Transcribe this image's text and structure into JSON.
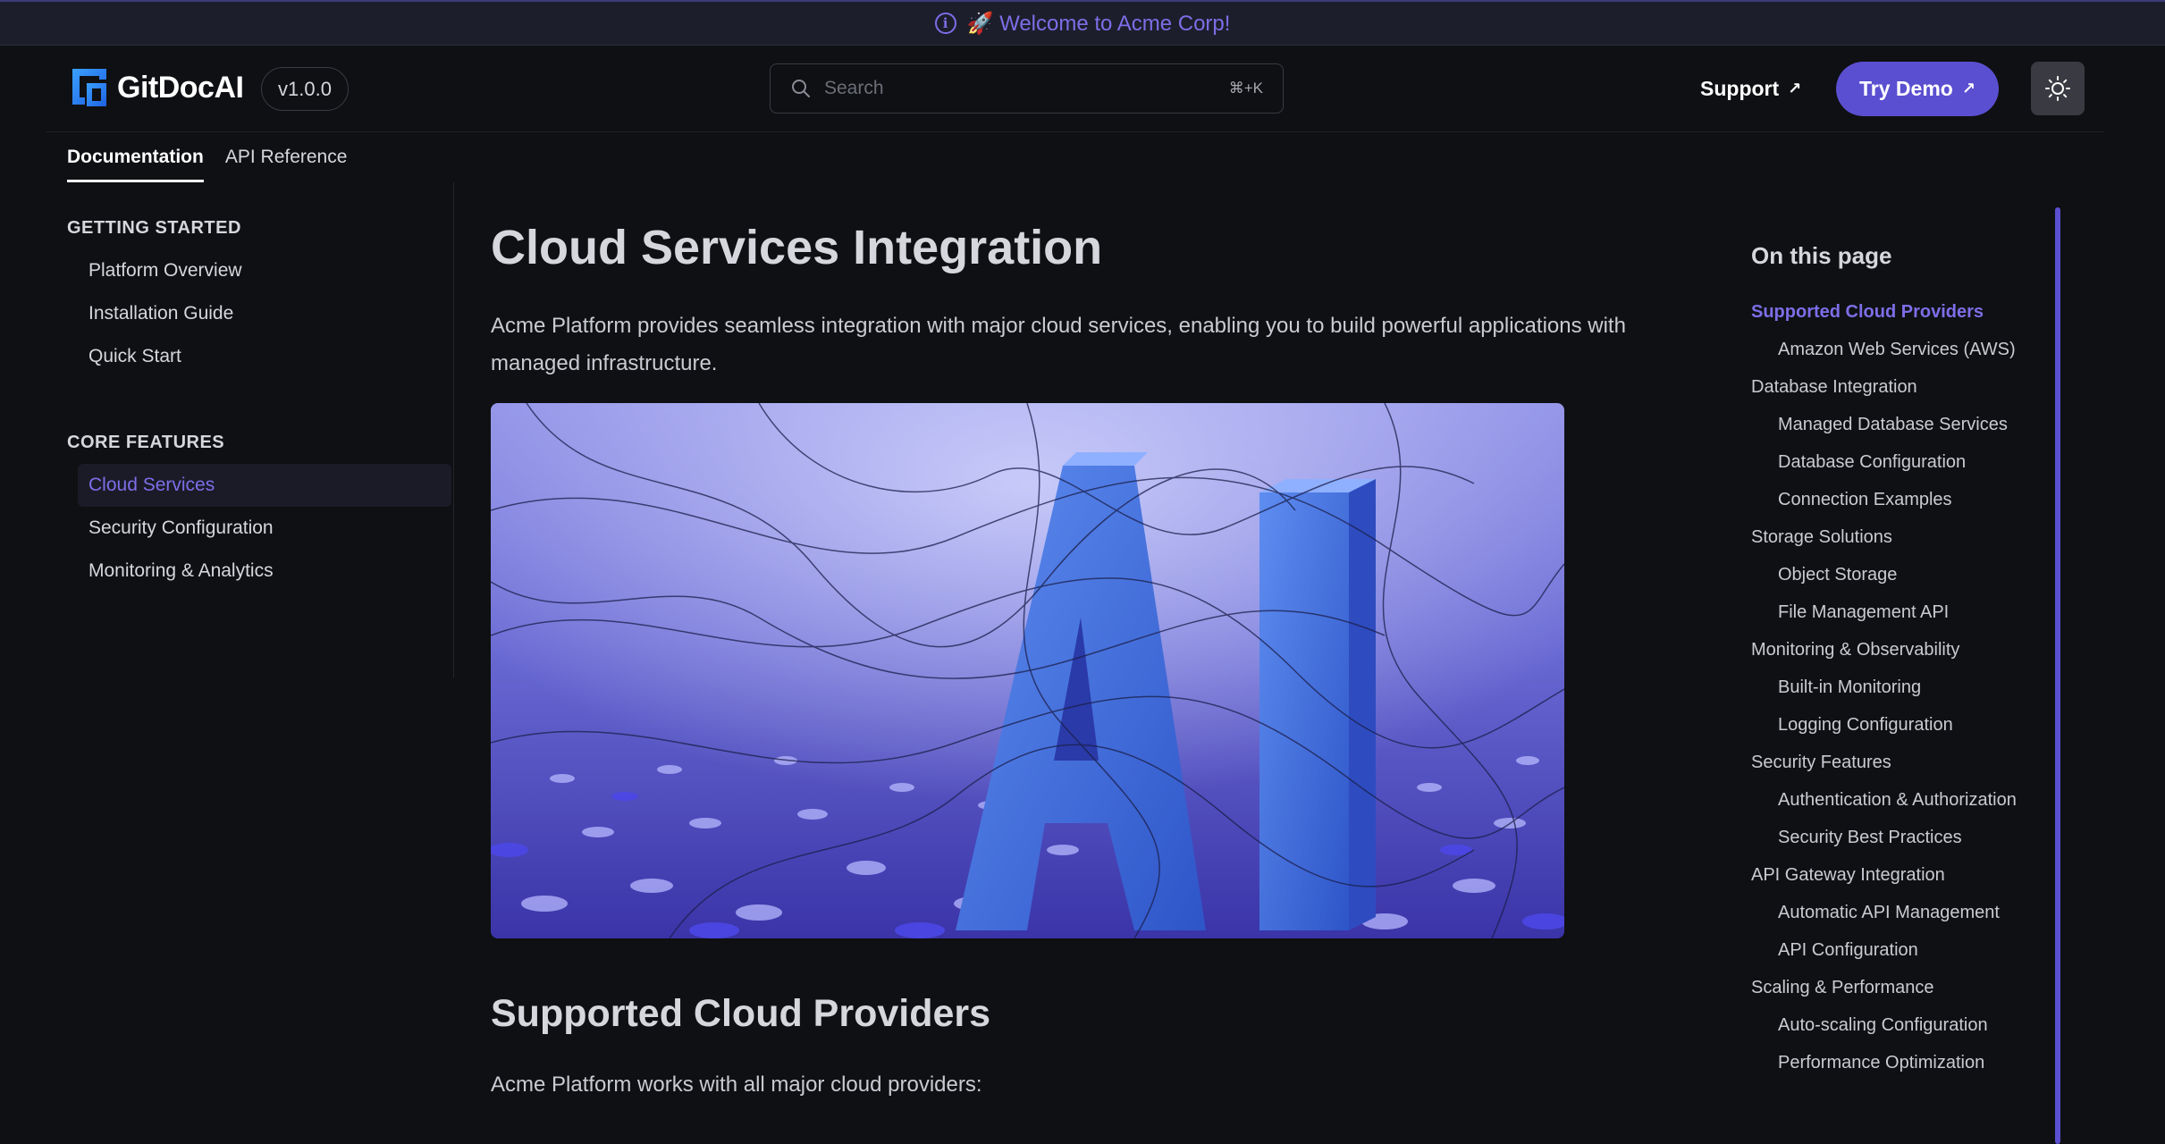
{
  "banner": {
    "text": "🚀 Welcome to Acme Corp!",
    "icon": "info-icon"
  },
  "header": {
    "logo_text": "GitDocAI",
    "version": "v1.0.0",
    "search": {
      "placeholder": "Search",
      "shortcut": "⌘+K"
    },
    "support_label": "Support",
    "try_demo_label": "Try Demo",
    "theme_icon": "sun-icon"
  },
  "tabs": [
    {
      "label": "Documentation",
      "active": true
    },
    {
      "label": "API Reference",
      "active": false
    }
  ],
  "sidebar": {
    "sections": [
      {
        "heading": "GETTING STARTED",
        "items": [
          {
            "label": "Platform Overview"
          },
          {
            "label": "Installation Guide"
          },
          {
            "label": "Quick Start"
          }
        ]
      },
      {
        "heading": "CORE FEATURES",
        "items": [
          {
            "label": "Cloud Services",
            "active": true
          },
          {
            "label": "Security Configuration"
          },
          {
            "label": "Monitoring & Analytics"
          }
        ]
      }
    ]
  },
  "main": {
    "title": "Cloud Services Integration",
    "intro": "Acme Platform provides seamless integration with major cloud services, enabling you to build powerful applications with managed infrastructure.",
    "hero_text": "AI",
    "section_title": "Supported Cloud Providers",
    "section_text": "Acme Platform works with all major cloud providers:"
  },
  "toc": {
    "title": "On this page",
    "items": [
      {
        "label": "Supported Cloud Providers",
        "level": 1,
        "active": true
      },
      {
        "label": "Amazon Web Services (AWS)",
        "level": 2
      },
      {
        "label": "Database Integration",
        "level": 1
      },
      {
        "label": "Managed Database Services",
        "level": 2
      },
      {
        "label": "Database Configuration",
        "level": 2
      },
      {
        "label": "Connection Examples",
        "level": 2
      },
      {
        "label": "Storage Solutions",
        "level": 1
      },
      {
        "label": "Object Storage",
        "level": 2
      },
      {
        "label": "File Management API",
        "level": 2
      },
      {
        "label": "Monitoring & Observability",
        "level": 1
      },
      {
        "label": "Built-in Monitoring",
        "level": 2
      },
      {
        "label": "Logging Configuration",
        "level": 2
      },
      {
        "label": "Security Features",
        "level": 1
      },
      {
        "label": "Authentication & Authorization",
        "level": 2
      },
      {
        "label": "Security Best Practices",
        "level": 2
      },
      {
        "label": "API Gateway Integration",
        "level": 1
      },
      {
        "label": "Automatic API Management",
        "level": 2
      },
      {
        "label": "API Configuration",
        "level": 2
      },
      {
        "label": "Scaling & Performance",
        "level": 1
      },
      {
        "label": "Auto-scaling Configuration",
        "level": 2
      },
      {
        "label": "Performance Optimization",
        "level": 2
      }
    ]
  },
  "colors": {
    "accent": "#5b4fd1",
    "accent_text": "#7d6ee8",
    "background": "#0f1013"
  }
}
